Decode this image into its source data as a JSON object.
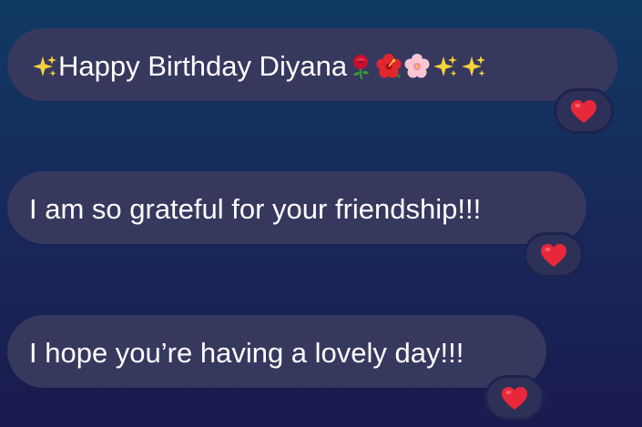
{
  "messages": [
    {
      "text": "Happy Birthday Diyana",
      "leading_emoji": [
        "sparkles-icon"
      ],
      "trailing_emoji": [
        "rose-icon",
        "hibiscus-icon",
        "cherry-blossom-icon",
        "sparkles-icon",
        "sparkles-icon"
      ],
      "reaction": "red-heart-icon"
    },
    {
      "text": "I am so grateful for your friendship!!!",
      "reaction": "red-heart-icon"
    },
    {
      "text": "I hope you’re having a lovely day!!!",
      "reaction": "red-heart-icon"
    }
  ],
  "colors": {
    "bubble": "#37385e",
    "background_top": "#103a64",
    "background_bottom": "#1a1a4e",
    "heart": "#e8283a"
  }
}
